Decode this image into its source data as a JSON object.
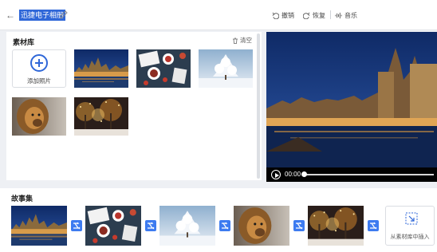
{
  "header": {
    "title": "迅捷电子相册",
    "undo_label": "撤销",
    "redo_label": "恢复",
    "music_label": "音乐"
  },
  "library": {
    "title": "素材库",
    "clear_label": "清空",
    "add_label": "添加照片",
    "photos": [
      "city-canal-night",
      "breakfast-table",
      "snowy-tree",
      "lion-portrait",
      "christmas-lights-night"
    ]
  },
  "player": {
    "time": "00:00",
    "progress": 0
  },
  "storyboard": {
    "title": "故事集",
    "frames": [
      "city-canal-night",
      "breakfast-table",
      "snowy-tree",
      "lion-portrait",
      "christmas-lights-night"
    ],
    "insert_label": "从素材库中插入"
  },
  "colors": {
    "accent": "#2f67d8",
    "swap_button": "#3d7bf0"
  }
}
